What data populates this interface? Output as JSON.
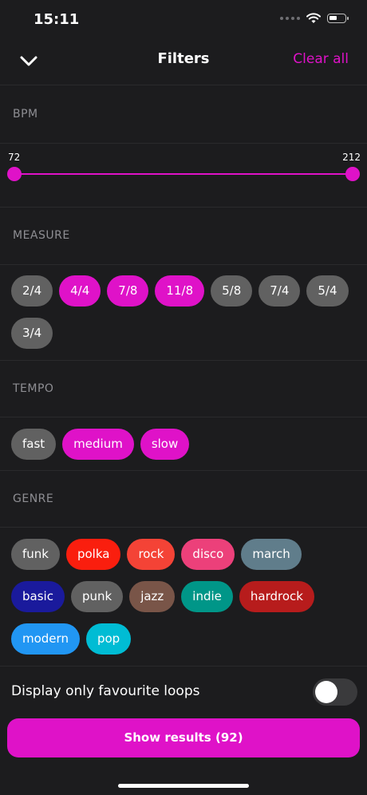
{
  "status": {
    "time": "15:11"
  },
  "header": {
    "title": "Filters",
    "clear_label": "Clear all"
  },
  "colors": {
    "accent": "#df12c8",
    "chip_default": "#616161"
  },
  "icons": {
    "back": "chevron-down-icon",
    "wifi": "wifi-icon",
    "battery": "battery-icon"
  },
  "bpm": {
    "label": "BPM",
    "min_label": "72",
    "max_label": "212",
    "range": [
      72,
      212
    ],
    "selected": [
      72,
      212
    ]
  },
  "measure": {
    "label": "MEASURE",
    "items": [
      {
        "label": "2/4",
        "selected": false
      },
      {
        "label": "4/4",
        "selected": true
      },
      {
        "label": "7/8",
        "selected": true
      },
      {
        "label": "11/8",
        "selected": true
      },
      {
        "label": "5/8",
        "selected": false
      },
      {
        "label": "7/4",
        "selected": false
      },
      {
        "label": "5/4",
        "selected": false
      },
      {
        "label": "3/4",
        "selected": false
      }
    ]
  },
  "tempo": {
    "label": "TEMPO",
    "items": [
      {
        "label": "fast",
        "selected": false
      },
      {
        "label": "medium",
        "selected": true
      },
      {
        "label": "slow",
        "selected": true
      }
    ]
  },
  "genre": {
    "label": "GENRE",
    "items": [
      {
        "label": "funk",
        "color": "#616161"
      },
      {
        "label": "polka",
        "color": "#fa1e0e"
      },
      {
        "label": "rock",
        "color": "#f44336"
      },
      {
        "label": "disco",
        "color": "#ec407a"
      },
      {
        "label": "march",
        "color": "#607d8b"
      },
      {
        "label": "basic",
        "color": "#1a1a9c"
      },
      {
        "label": "punk",
        "color": "#616161"
      },
      {
        "label": "jazz",
        "color": "#795548"
      },
      {
        "label": "indie",
        "color": "#009688"
      },
      {
        "label": "hardrock",
        "color": "#b71c1c"
      },
      {
        "label": "modern",
        "color": "#2196f3"
      },
      {
        "label": "pop",
        "color": "#00bcd4"
      }
    ]
  },
  "favourites": {
    "label": "Display only favourite loops",
    "enabled": false
  },
  "results": {
    "label": "Show results (92)"
  }
}
